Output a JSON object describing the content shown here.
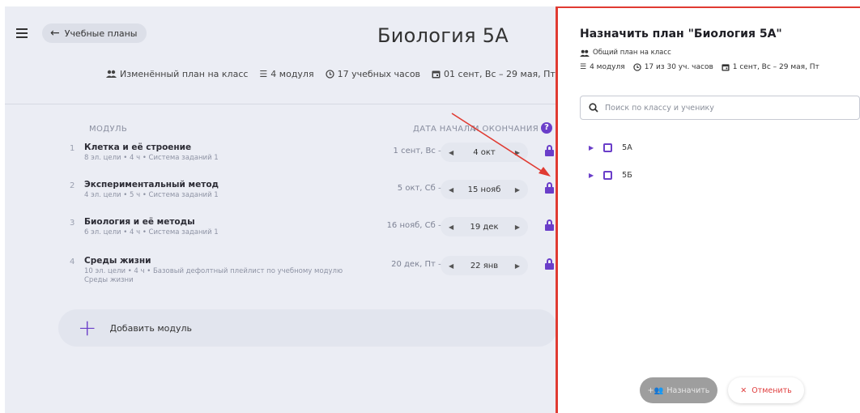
{
  "background": {
    "back_label": "Учебные планы",
    "title": "Биология 5А",
    "meta": {
      "plan_type": "Изменённый план на класс",
      "modules": "4 модуля",
      "hours": "17 учебных часов",
      "dates": "01 сент, Вс – 29 мая, Пт"
    },
    "columns": {
      "module": "МОДУЛЬ",
      "start": "ДАТА НАЧАЛА",
      "end": "И ОКОНЧАНИЯ",
      "help": "?"
    },
    "modules": [
      {
        "num": "1",
        "name": "Клетка и её строение",
        "sub": "8 эл. цели • 4 ч • Система заданий 1",
        "start": "1 сент, Вс –",
        "end": "4 окт"
      },
      {
        "num": "2",
        "name": "Экспериментальный метод",
        "sub": "4 эл. цели • 5 ч • Система заданий 1",
        "start": "5 окт, Сб –",
        "end": "15 нояб"
      },
      {
        "num": "3",
        "name": "Биология и её методы",
        "sub": "6 эл. цели • 4 ч • Система заданий 1",
        "start": "16 нояб, Сб –",
        "end": "19 дек"
      },
      {
        "num": "4",
        "name": "Среды жизни",
        "sub": "10 эл. цели • 4 ч • Базовый дефолтный плейлист по учебному модулю Среды жизни",
        "start": "20 дек, Пт –",
        "end": "22 янв"
      }
    ],
    "add_module": "Добавить модуль"
  },
  "panel": {
    "title": "Назначить план \"Биология 5А\"",
    "subtitle": "Общий план на класс",
    "meta": {
      "modules": "4 модуля",
      "hours": "17 из 30 уч. часов",
      "dates": "1 сент, Вс – 29 мая, Пт"
    },
    "search_placeholder": "Поиск по классу и ученику",
    "classes": [
      "5А",
      "5Б"
    ],
    "assign_label": "Назначить",
    "cancel_label": "Отменить"
  },
  "colors": {
    "accent": "#6a3ec9",
    "annotation": "#e03b32",
    "cancel": "#e04040"
  },
  "icons": [
    "menu-icon",
    "arrow-left-icon",
    "users-icon",
    "list-icon",
    "clock-icon",
    "calendar-icon",
    "pencil-icon",
    "lock-icon",
    "plus-icon",
    "search-icon",
    "caret-right-icon",
    "checkbox-icon",
    "add-user-icon",
    "close-icon"
  ]
}
